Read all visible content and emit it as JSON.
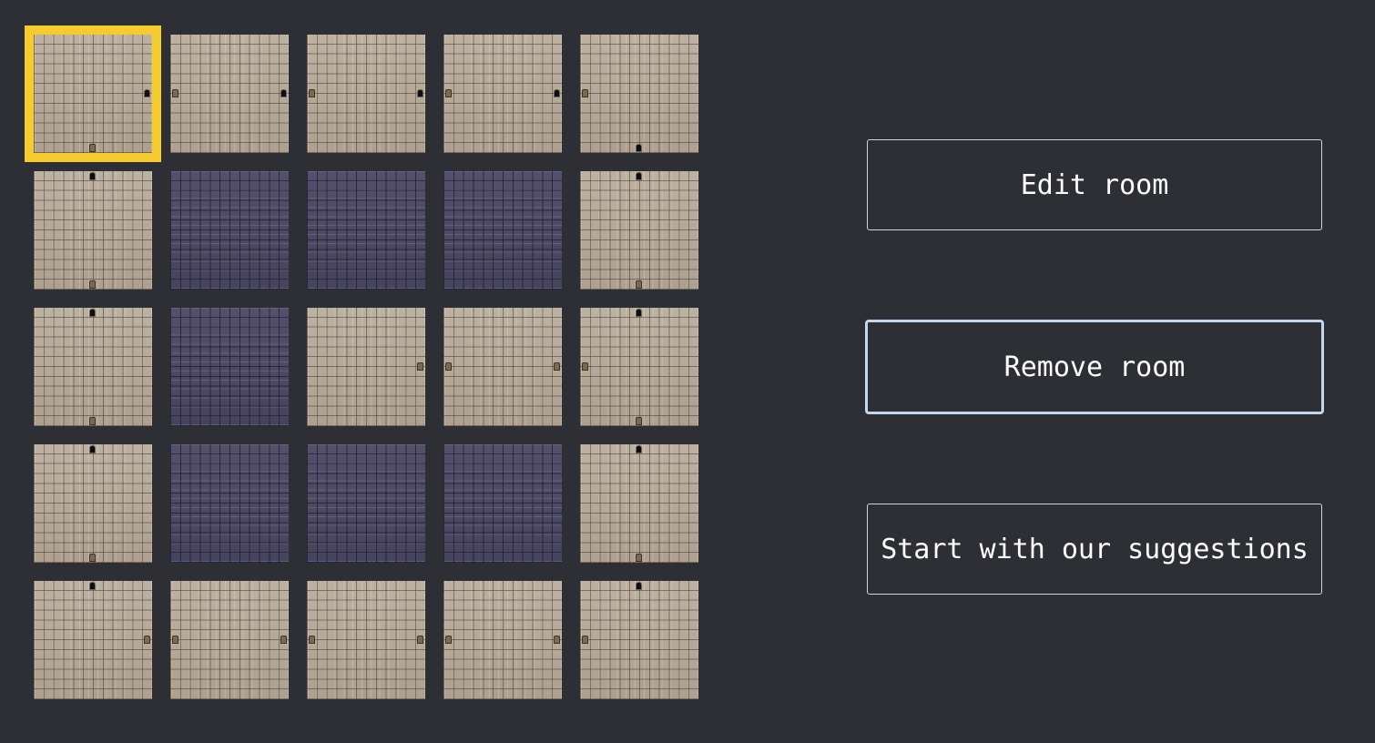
{
  "grid": {
    "rows": 5,
    "cols": 5,
    "selected": [
      0,
      0
    ],
    "rooms": [
      [
        {
          "type": "floor",
          "doors": [
            {
              "side": "bottom",
              "style": "wood"
            },
            {
              "side": "right",
              "style": "dark"
            }
          ]
        },
        {
          "type": "floor",
          "doors": [
            {
              "side": "left",
              "style": "wood"
            },
            {
              "side": "right",
              "style": "dark"
            }
          ]
        },
        {
          "type": "floor",
          "doors": [
            {
              "side": "left",
              "style": "wood"
            },
            {
              "side": "right",
              "style": "dark"
            }
          ]
        },
        {
          "type": "floor",
          "doors": [
            {
              "side": "left",
              "style": "wood"
            },
            {
              "side": "right",
              "style": "dark"
            }
          ]
        },
        {
          "type": "floor",
          "doors": [
            {
              "side": "left",
              "style": "wood"
            },
            {
              "side": "bottom",
              "style": "dark"
            }
          ]
        }
      ],
      [
        {
          "type": "floor",
          "doors": [
            {
              "side": "top",
              "style": "dark"
            },
            {
              "side": "bottom",
              "style": "wood"
            }
          ]
        },
        {
          "type": "empty",
          "doors": []
        },
        {
          "type": "empty",
          "doors": []
        },
        {
          "type": "empty",
          "doors": []
        },
        {
          "type": "floor",
          "doors": [
            {
              "side": "top",
              "style": "dark"
            },
            {
              "side": "bottom",
              "style": "wood"
            }
          ]
        }
      ],
      [
        {
          "type": "floor",
          "doors": [
            {
              "side": "top",
              "style": "dark"
            },
            {
              "side": "bottom",
              "style": "wood"
            }
          ]
        },
        {
          "type": "empty",
          "doors": []
        },
        {
          "type": "floor",
          "doors": [
            {
              "side": "right",
              "style": "wood"
            }
          ]
        },
        {
          "type": "floor",
          "doors": [
            {
              "side": "left",
              "style": "wood"
            },
            {
              "side": "right",
              "style": "wood"
            }
          ]
        },
        {
          "type": "floor",
          "doors": [
            {
              "side": "left",
              "style": "wood"
            },
            {
              "side": "top",
              "style": "dark"
            },
            {
              "side": "bottom",
              "style": "wood"
            }
          ]
        }
      ],
      [
        {
          "type": "floor",
          "doors": [
            {
              "side": "top",
              "style": "dark"
            },
            {
              "side": "bottom",
              "style": "wood"
            }
          ]
        },
        {
          "type": "empty",
          "doors": []
        },
        {
          "type": "empty",
          "doors": []
        },
        {
          "type": "empty",
          "doors": []
        },
        {
          "type": "floor",
          "doors": [
            {
              "side": "top",
              "style": "dark"
            },
            {
              "side": "bottom",
              "style": "wood"
            }
          ]
        }
      ],
      [
        {
          "type": "floor",
          "doors": [
            {
              "side": "top",
              "style": "dark"
            },
            {
              "side": "right",
              "style": "wood"
            }
          ]
        },
        {
          "type": "floor",
          "doors": [
            {
              "side": "left",
              "style": "wood"
            },
            {
              "side": "right",
              "style": "wood"
            }
          ]
        },
        {
          "type": "floor",
          "doors": [
            {
              "side": "left",
              "style": "wood"
            },
            {
              "side": "right",
              "style": "wood"
            }
          ]
        },
        {
          "type": "floor",
          "doors": [
            {
              "side": "left",
              "style": "wood"
            },
            {
              "side": "right",
              "style": "wood"
            }
          ]
        },
        {
          "type": "floor",
          "doors": [
            {
              "side": "left",
              "style": "wood"
            },
            {
              "side": "top",
              "style": "dark"
            }
          ]
        }
      ]
    ]
  },
  "actions": {
    "edit_label": "Edit room",
    "remove_label": "Remove room",
    "suggest_label": "Start with our suggestions"
  },
  "colors": {
    "background": "#2d2f34",
    "selection": "#f5cc2e",
    "focus_border": "#c4d6ee",
    "floor_tile": "#b5a898",
    "empty_tile": "#4a4760"
  }
}
